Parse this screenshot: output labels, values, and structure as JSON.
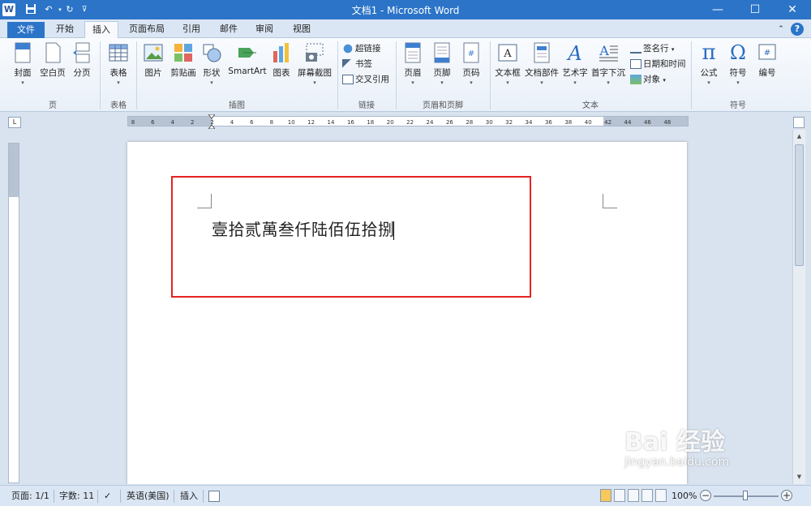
{
  "window": {
    "title": "文档1 - Microsoft Word",
    "app_icon_letter": "W",
    "minimize": "—",
    "maximize": "☐",
    "close": "✕"
  },
  "tabs": [
    {
      "label": "文件"
    },
    {
      "label": "开始"
    },
    {
      "label": "插入"
    },
    {
      "label": "页面布局"
    },
    {
      "label": "引用"
    },
    {
      "label": "邮件"
    },
    {
      "label": "审阅"
    },
    {
      "label": "视图"
    }
  ],
  "ribbon": {
    "groups": [
      {
        "label": "页"
      },
      {
        "label": "表格"
      },
      {
        "label": "插图"
      },
      {
        "label": "链接"
      },
      {
        "label": "页眉和页脚"
      },
      {
        "label": "文本"
      },
      {
        "label": "符号"
      }
    ],
    "buttons": {
      "cover": "封面",
      "blank_page": "空白页",
      "page_break": "分页",
      "table": "表格",
      "picture": "图片",
      "clipart": "剪贴画",
      "shapes": "形状",
      "smartart": "SmartArt",
      "chart": "图表",
      "screenshot": "屏幕截图",
      "hyperlink": "超链接",
      "bookmark": "书签",
      "cross_ref": "交叉引用",
      "header": "页眉",
      "footer": "页脚",
      "page_number": "页码",
      "textbox": "文本框",
      "quick_parts": "文档部件",
      "wordart": "艺术字",
      "dropcap": "首字下沉",
      "signature_line": "签名行",
      "date_time": "日期和时间",
      "object": "对象",
      "equation": "公式",
      "symbol": "符号",
      "numbering": "编号"
    }
  },
  "ruler": {
    "ticks": [
      "8",
      "6",
      "4",
      "2",
      "2",
      "4",
      "6",
      "8",
      "10",
      "12",
      "14",
      "16",
      "18",
      "20",
      "22",
      "24",
      "26",
      "28",
      "30",
      "32",
      "34",
      "36",
      "38",
      "40",
      "42",
      "44",
      "46",
      "48"
    ],
    "corner_label": "L"
  },
  "document": {
    "text": "壹拾贰萬叁仟陆佰伍拾捌"
  },
  "statusbar": {
    "page": "页面: 1/1",
    "words": "字数: 11",
    "language": "英语(美国)",
    "mode": "插入",
    "zoom": "100%"
  },
  "watermark": {
    "logo": "Bai 经验",
    "url": "jingyan.baidu.com"
  },
  "colors": {
    "accent": "#2b74c8",
    "highlight_box": "#e42323"
  }
}
